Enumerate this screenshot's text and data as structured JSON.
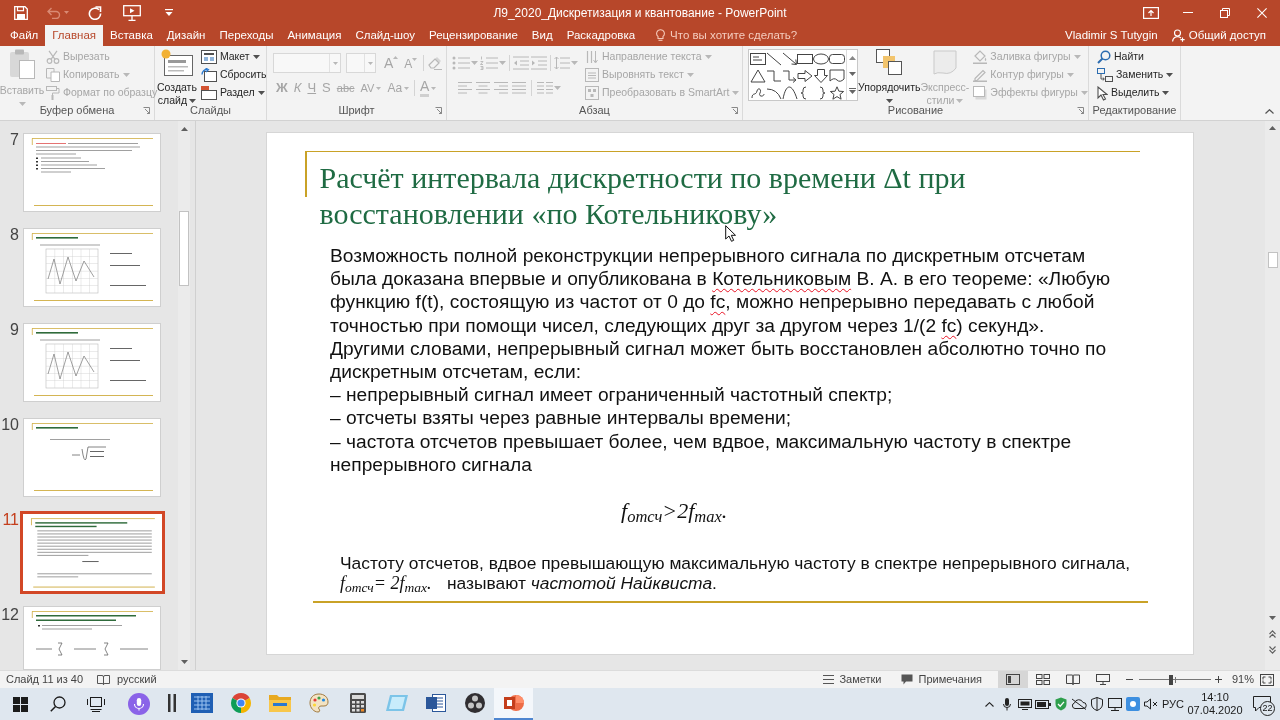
{
  "title_bar": {
    "quick_access": [
      {
        "kind": "save",
        "disabled": false,
        "dropdown": false
      },
      {
        "kind": "undo",
        "disabled": true,
        "dropdown": true
      },
      {
        "kind": "repeat",
        "disabled": false,
        "dropdown": false
      },
      {
        "kind": "slideshow",
        "disabled": false,
        "dropdown": false
      },
      {
        "kind": "customize",
        "disabled": false,
        "dropdown": false
      }
    ],
    "title": "Л9_2020_Дискретизация и квантование - PowerPoint",
    "controls": [
      {
        "kind": "ribbon_options"
      },
      {
        "kind": "minimize"
      },
      {
        "kind": "restore"
      },
      {
        "kind": "close"
      }
    ]
  },
  "tabs": [
    {
      "label": "Файл",
      "selected": false
    },
    {
      "label": "Главная",
      "selected": true
    },
    {
      "label": "Вставка",
      "selected": false
    },
    {
      "label": "Дизайн",
      "selected": false
    },
    {
      "label": "Переходы",
      "selected": false
    },
    {
      "label": "Анимация",
      "selected": false
    },
    {
      "label": "Слайд-шоу",
      "selected": false
    },
    {
      "label": "Рецензирование",
      "selected": false
    },
    {
      "label": "Вид",
      "selected": false
    },
    {
      "label": "Раскадровка",
      "selected": false
    }
  ],
  "tell_me": {
    "placeholder": "Что вы хотите сделать?"
  },
  "account": {
    "user": "Vladimir S Tutygin",
    "share": "Общий доступ"
  },
  "ribbon": {
    "clipboard": {
      "label": "Буфер обмена",
      "paste": {
        "label": "Вставить",
        "disabled": true,
        "dropdown": true
      },
      "items": [
        {
          "kind": "cut",
          "label": "Вырезать",
          "disabled": true,
          "dropdown": false
        },
        {
          "kind": "copy",
          "label": "Копировать",
          "disabled": true,
          "dropdown": true
        },
        {
          "kind": "format_painter",
          "label": "Формат по образцу",
          "disabled": true,
          "dropdown": false
        }
      ]
    },
    "slides": {
      "label": "Слайды",
      "new_slide": {
        "label": "Создать слайд",
        "disabled": false,
        "dropdown": true
      },
      "items": [
        {
          "kind": "layout",
          "label": "Макет",
          "disabled": false,
          "dropdown": true
        },
        {
          "kind": "reset",
          "label": "Сбросить",
          "disabled": false,
          "dropdown": false
        },
        {
          "kind": "section",
          "label": "Раздел",
          "disabled": false,
          "dropdown": true
        }
      ]
    },
    "font": {
      "label": "Шрифт",
      "font_name_field": {
        "disabled": true
      },
      "font_size_field": {
        "disabled": true
      },
      "size_buttons": [
        {
          "kind": "grow",
          "label": "A",
          "disabled": true
        },
        {
          "kind": "shrink",
          "label": "A",
          "disabled": true
        }
      ],
      "clear_formatting": {
        "disabled": true
      },
      "format_buttons": [
        {
          "kind": "bold",
          "label": "Ж",
          "disabled": true,
          "dropdown": false
        },
        {
          "kind": "italic",
          "label": "К",
          "disabled": true,
          "dropdown": false
        },
        {
          "kind": "underline",
          "label": "Ч",
          "disabled": true,
          "dropdown": false
        },
        {
          "kind": "shadow",
          "label": "S",
          "disabled": true,
          "dropdown": false
        },
        {
          "kind": "strikethrough",
          "label": "abc",
          "disabled": true,
          "dropdown": false
        },
        {
          "kind": "character_spacing",
          "label": "AV",
          "disabled": true,
          "dropdown": true
        },
        {
          "kind": "change_case",
          "label": "Aa",
          "disabled": true,
          "dropdown": true
        },
        {
          "kind": "font_color",
          "label": "A",
          "disabled": true,
          "dropdown": true
        }
      ]
    },
    "paragraph": {
      "label": "Абзац",
      "row_1": [
        {
          "kind": "bullets",
          "disabled": true,
          "dropdown": true
        },
        {
          "kind": "numbering",
          "disabled": true,
          "dropdown": true
        },
        {
          "kind": "decrease_indent",
          "disabled": true,
          "dropdown": false
        },
        {
          "kind": "increase_indent",
          "disabled": true,
          "dropdown": false
        },
        {
          "kind": "line_spacing",
          "disabled": true,
          "dropdown": true
        }
      ],
      "row_2": [
        {
          "kind": "align_left",
          "disabled": true,
          "dropdown": false
        },
        {
          "kind": "align_center",
          "disabled": true,
          "dropdown": false
        },
        {
          "kind": "align_right",
          "disabled": true,
          "dropdown": false
        },
        {
          "kind": "justify",
          "disabled": true,
          "dropdown": false
        },
        {
          "kind": "columns",
          "disabled": true,
          "dropdown": true
        }
      ],
      "items": [
        {
          "kind": "text_direction",
          "label": "Направление текста",
          "disabled": true,
          "dropdown": true
        },
        {
          "kind": "align_text",
          "label": "Выровнять текст",
          "disabled": true,
          "dropdown": true
        },
        {
          "kind": "smartart",
          "label": "Преобразовать в SmartArt",
          "disabled": true,
          "dropdown": true
        }
      ]
    },
    "drawing": {
      "label": "Рисование",
      "arrange": {
        "label": "Упорядочить",
        "disabled": false,
        "dropdown": true
      },
      "quick_styles": {
        "label": "Экспресс-стили",
        "disabled": true,
        "dropdown": true
      },
      "items": [
        {
          "kind": "shape_fill",
          "label": "Заливка фигуры",
          "disabled": true,
          "dropdown": true
        },
        {
          "kind": "shape_outline",
          "label": "Контур фигуры",
          "disabled": true,
          "dropdown": true
        },
        {
          "kind": "shape_effects",
          "label": "Эффекты фигуры",
          "disabled": true,
          "dropdown": true
        }
      ]
    },
    "editing": {
      "label": "Редактирование",
      "items": [
        {
          "kind": "find",
          "label": "Найти",
          "disabled": false,
          "dropdown": false
        },
        {
          "kind": "replace",
          "label": "Заменить",
          "disabled": false,
          "dropdown": true
        },
        {
          "kind": "select",
          "label": "Выделить",
          "disabled": false,
          "dropdown": true
        }
      ]
    }
  },
  "thumbnails": [
    {
      "number": "7",
      "kind": "bullets",
      "selected": false
    },
    {
      "number": "8",
      "kind": "chart",
      "selected": false
    },
    {
      "number": "9",
      "kind": "chart",
      "selected": false
    },
    {
      "number": "10",
      "kind": "formula",
      "selected": false
    },
    {
      "number": "11",
      "kind": "text",
      "selected": true
    },
    {
      "number": "12",
      "kind": "sum_formula",
      "selected": false
    }
  ],
  "slide": {
    "title": "Расчёт интервала дискретности по времени Δt при восстановлении «по Котельникову»",
    "body": [
      {
        "runs": [
          {
            "text": "Возможность полной реконструкции непрерывного сигнала по дискретным отсчетам была доказана впервые и опубликована в  ",
            "spell_error": false
          },
          {
            "text": "Котельниковым",
            "spell_error": true
          },
          {
            "text": " В. А. в его теореме: «Любую функцию f(t), состоящую из частот от 0 до ",
            "spell_error": false
          },
          {
            "text": "fc",
            "spell_error": true
          },
          {
            "text": ", можно непрерывно передавать с любой точностью при помощи чисел, следующих друг за другом через 1/(2 ",
            "spell_error": false
          },
          {
            "text": "fc",
            "spell_error": true
          },
          {
            "text": ") секунд».",
            "spell_error": false
          }
        ]
      },
      {
        "runs": [
          {
            "text": "Другими словами, непрерывный сигнал может быть восстановлен абсолютно точно по дискретным отсчетам, если:",
            "spell_error": false
          }
        ]
      },
      {
        "runs": [
          {
            "text": "– непрерывный сигнал имеет ограниченный частотный спектр;",
            "spell_error": false
          }
        ]
      },
      {
        "runs": [
          {
            "text": "– отсчеты взяты через равные интервалы времени;",
            "spell_error": false
          }
        ]
      },
      {
        "runs": [
          {
            "text": "– частота отсчетов превышает более, чем вдвое, максимальную частоту в спектре непрерывного сигнала",
            "spell_error": false
          }
        ]
      }
    ],
    "formula": "f$_{отсч}$>2f$_{max}$.",
    "nyquist": {
      "text": "Частоту отсчетов, вдвое превышающую максимальную частоту в спектре непрерывного сигнала,",
      "formula": "f$_{отсч}$= 2f$_{max}$.",
      "definition": "называют *частотой Найквиста*."
    }
  },
  "status_bar": {
    "slide_info": "Слайд 11 из 40",
    "language": "русский",
    "notes": "Заметки",
    "comments": "Примечания",
    "views": [
      {
        "kind": "normal",
        "selected": true
      },
      {
        "kind": "sorter",
        "selected": false
      },
      {
        "kind": "reading",
        "selected": false
      },
      {
        "kind": "slideshow",
        "selected": false
      }
    ],
    "zoom": {
      "level": 0.45,
      "reading": "91%"
    }
  },
  "taskbar": {
    "apps": [
      {
        "kind": "bars",
        "selected": false
      },
      {
        "kind": "grid",
        "selected": false
      },
      {
        "kind": "browser",
        "selected": false
      },
      {
        "kind": "folder",
        "selected": false
      },
      {
        "kind": "paint",
        "selected": false
      },
      {
        "kind": "calculator",
        "selected": false
      },
      {
        "kind": "tile",
        "selected": false
      },
      {
        "kind": "word",
        "selected": false
      },
      {
        "kind": "disc",
        "selected": false
      },
      {
        "kind": "powerpoint",
        "selected": true
      }
    ],
    "language": "РУС",
    "time": "14:10",
    "date": "07.04.2020",
    "notifications": "22"
  }
}
